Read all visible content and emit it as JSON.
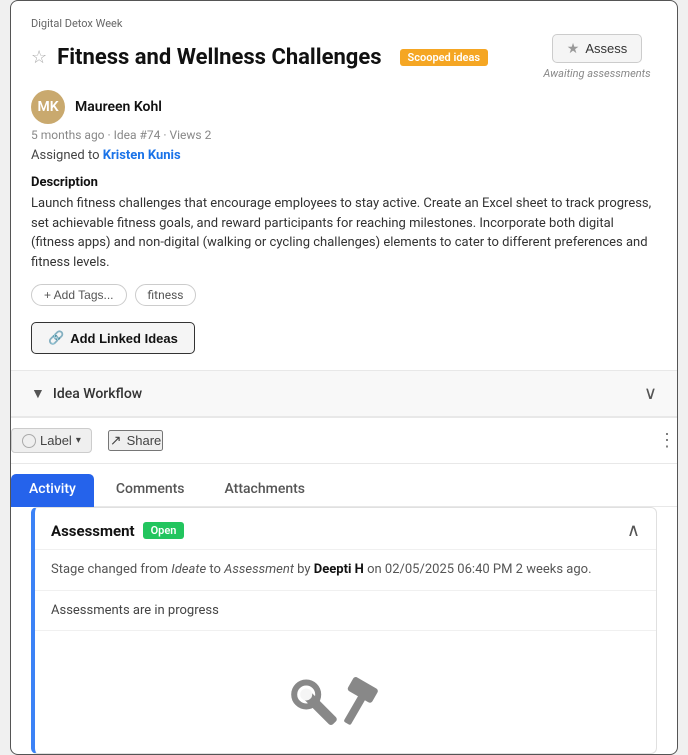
{
  "category": "Digital Detox Week",
  "title": "Fitness and Wellness Challenges",
  "badge_scooped": "Scooped ideas",
  "assess_button_label": "Assess",
  "awaiting_text": "Awaiting assessments",
  "author": {
    "name": "Maureen Kohl",
    "initials": "MK"
  },
  "meta": "5 months ago · Idea #74 · Views 2",
  "assigned_label": "Assigned to",
  "assigned_to": "Kristen Kunis",
  "description_label": "Description",
  "description_text": "Launch fitness challenges that encourage employees to stay active. Create an Excel sheet to track progress, set achievable fitness goals, and reward participants for reaching milestones. Incorporate both digital (fitness apps) and non-digital (walking or cycling challenges) elements to cater to different preferences and fitness levels.",
  "tags": {
    "add_label": "+ Add Tags...",
    "items": [
      "fitness"
    ]
  },
  "linked_ideas_label": "Add 🔗 Linked Ideas",
  "workflow_label": "Idea Workflow",
  "label_btn": "Label",
  "share_btn": "Share",
  "tabs": [
    {
      "id": "activity",
      "label": "Activity",
      "active": true
    },
    {
      "id": "comments",
      "label": "Comments",
      "active": false
    },
    {
      "id": "attachments",
      "label": "Attachments",
      "active": false
    }
  ],
  "assessment": {
    "title": "Assessment",
    "badge": "Open",
    "stage_change": "Stage changed from",
    "from_stage": "Ideate",
    "to_stage": "Assessment",
    "by_label": "by",
    "author": "Deepti H",
    "on_label": "on",
    "date": "02/05/2025 06:40 PM 2 weeks ago.",
    "in_progress_text": "Assessments are in progress"
  }
}
